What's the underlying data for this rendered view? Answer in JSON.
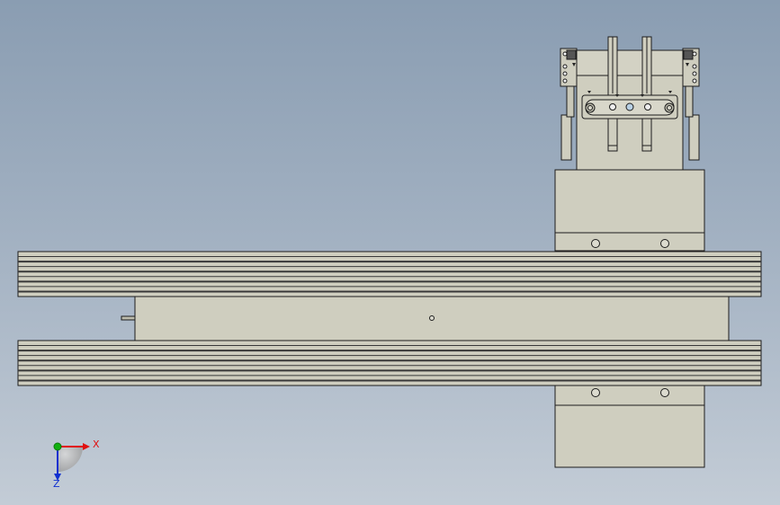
{
  "viewport": {
    "background_top": "#8a9db2",
    "background_bottom": "#c3ccd6"
  },
  "model": {
    "part_fill": "#cfcebf",
    "part_stroke": "#1c1c1c",
    "rail_count": 2,
    "rail_grooves": 9,
    "rail_groove_dark": "#383838"
  },
  "triad": {
    "x_label": "X",
    "z_label": "Z",
    "x_color": "#e01010",
    "y_color": "#10b010",
    "z_color": "#1030d0"
  }
}
